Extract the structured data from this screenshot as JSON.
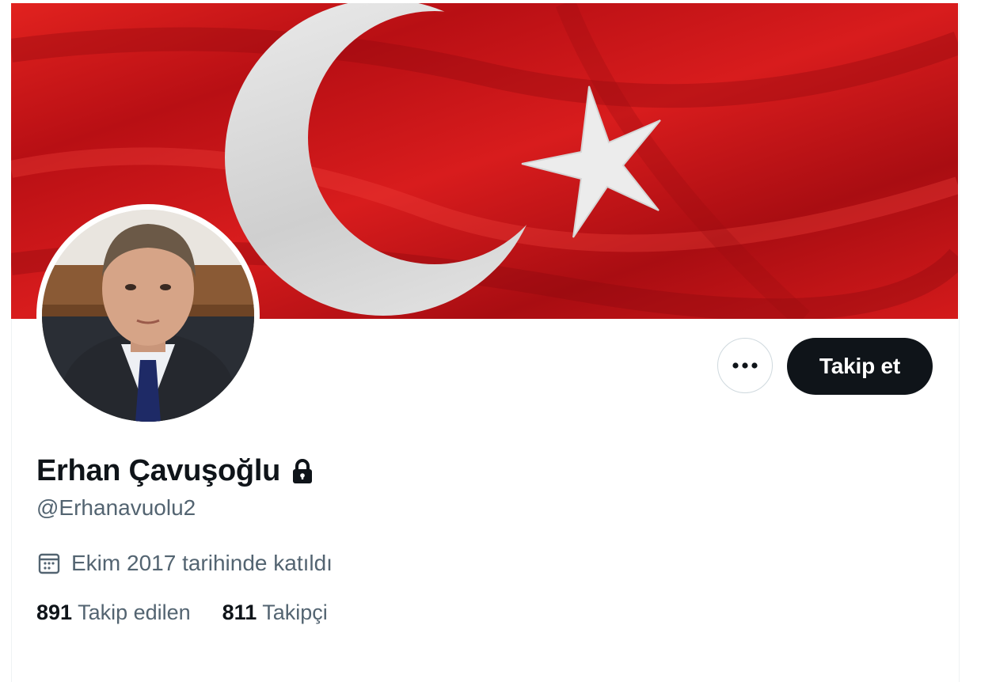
{
  "profile": {
    "display_name": "Erhan Çavuşoğlu",
    "handle": "@Erhanavuolu2",
    "joined": "Ekim 2017 tarihinde katıldı",
    "protected_icon": "lock-icon",
    "joined_icon": "calendar-icon"
  },
  "actions": {
    "more_icon": "more-options-icon",
    "follow_label": "Takip et"
  },
  "stats": {
    "following_count": "891",
    "following_label": "Takip edilen",
    "followers_count": "811",
    "followers_label": "Takipçi"
  },
  "colors": {
    "flag_red": "#c8161b",
    "button_dark": "#0f1419",
    "secondary_text": "#536471"
  }
}
